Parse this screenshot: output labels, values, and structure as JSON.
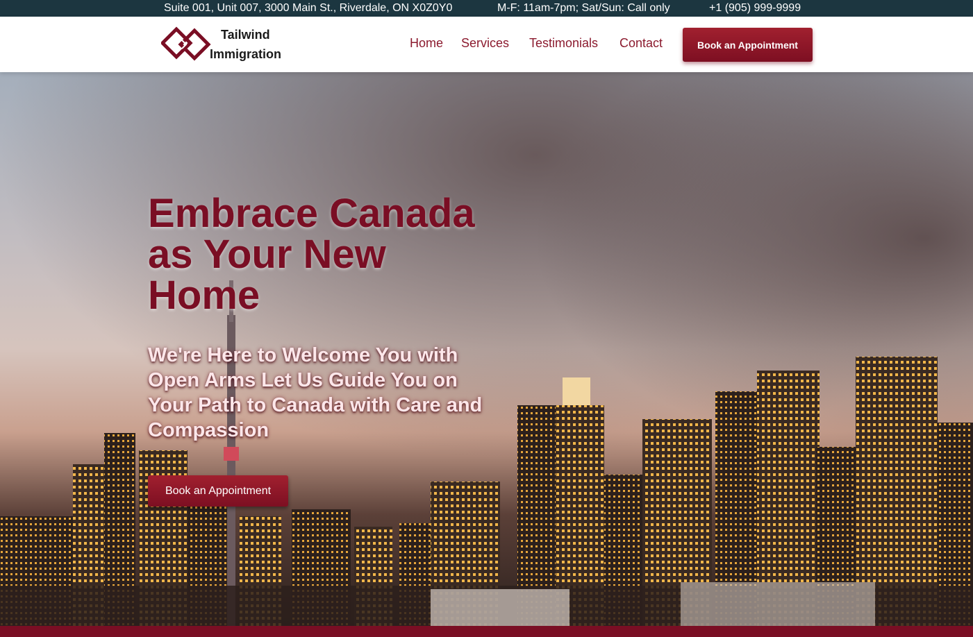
{
  "topbar": {
    "address": "Suite 001, Unit 007, 3000 Main St., Riverdale, ON X0Z0Y0",
    "hours": "M-F: 11am-7pm; Sat/Sun: Call only",
    "phone": "+1 (905) 999-9999"
  },
  "header": {
    "logo": {
      "line1": "Tailwind",
      "line2": "Immigration",
      "icon": "interlocking-diamonds-icon"
    },
    "nav": [
      {
        "label": "Home"
      },
      {
        "label": "Services"
      },
      {
        "label": "Testimonials"
      },
      {
        "label": "Contact"
      }
    ],
    "cta_label": "Book an Appointment"
  },
  "hero": {
    "title": "Embrace Canada as Your New Home",
    "subtitle": "We're Here to Welcome You with Open Arms Let Us Guide You on Your Path to Canada with Care and Compassion",
    "cta_label": "Book an Appointment",
    "background": "toronto-skyline-night-image"
  },
  "colors": {
    "brand": "#7a0e24",
    "button": "#931a2b",
    "topbar": "#1c3640",
    "nav_text": "#8b1a2e"
  }
}
